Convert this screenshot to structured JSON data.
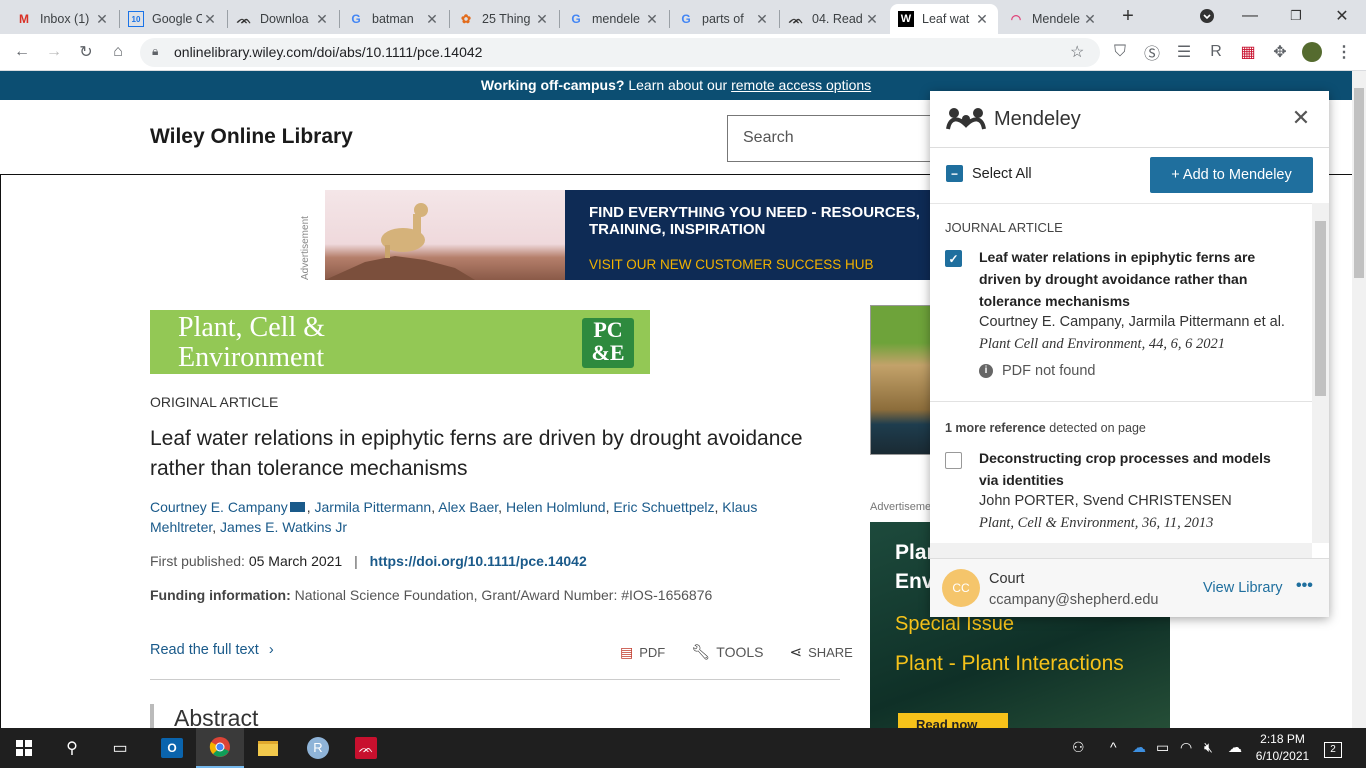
{
  "browser": {
    "tabs": [
      {
        "label": "Inbox (1)",
        "favicon": "gmail-icon",
        "active": false
      },
      {
        "label": "Google C",
        "favicon": "google-calendar-icon",
        "active": false
      },
      {
        "label": "Downloa",
        "favicon": "mendeley-icon",
        "active": false
      },
      {
        "label": "batman",
        "favicon": "google-icon",
        "active": false
      },
      {
        "label": "25 Thing",
        "favicon": "butterfly-icon",
        "active": false
      },
      {
        "label": "mendele",
        "favicon": "google-icon",
        "active": false
      },
      {
        "label": "parts of",
        "favicon": "google-icon",
        "active": false
      },
      {
        "label": "04. Read",
        "favicon": "mendeley-icon",
        "active": false
      },
      {
        "label": "Leaf wat",
        "favicon": "wiley-icon",
        "active": true
      },
      {
        "label": "Mendele",
        "favicon": "rainbow-icon",
        "active": false
      }
    ],
    "url": "onlinelibrary.wiley.com/doi/abs/10.1111/pce.14042"
  },
  "banner": {
    "bold": "Working off-campus?",
    "text": " Learn about our ",
    "link": "remote access options"
  },
  "header": {
    "site_title": "Wiley Online Library",
    "search_placeholder": "Search"
  },
  "ad_top": {
    "label": "Advertisement",
    "headline": "FIND EVERYTHING YOU NEED - RESOURCES, TRAINING, INSPIRATION",
    "link": "VISIT OUR NEW CUSTOMER SUCCESS HUB"
  },
  "journal": {
    "name_line1": "Plant, Cell &",
    "name_line2": "Environment",
    "logo_line1": "PC",
    "logo_line2": "&E"
  },
  "article": {
    "type": "ORIGINAL ARTICLE",
    "title": "Leaf water relations in epiphytic ferns are driven by drought avoidance rather than tolerance mechanisms",
    "authors": [
      "Courtney E. Campany",
      "Jarmila Pittermann",
      "Alex Baer",
      "Helen Holmlund",
      "Eric Schuettpelz",
      "Klaus Mehltreter",
      "James E. Watkins Jr"
    ],
    "first_published_label": "First published:",
    "first_published_date": "05 March 2021",
    "doi": "https://doi.org/10.1111/pce.14042",
    "funding_label": "Funding information:",
    "funding_text": "National Science Foundation, Grant/Award Number: #IOS-1656876",
    "read_full": "Read the full text",
    "tools": {
      "pdf": "PDF",
      "tools": "TOOLS",
      "share": "SHARE"
    },
    "abstract_heading": "Abstract"
  },
  "ad_side": {
    "label": "Advertisement",
    "line1": "Plant,",
    "line2": "Environment",
    "special": "Special Issue",
    "topic": "Plant - Plant Interactions",
    "button": "Read now"
  },
  "mendeley": {
    "title": "Mendeley",
    "select_all": "Select All",
    "add_button": "+ Add to Mendeley",
    "section_label": "JOURNAL ARTICLE",
    "items": [
      {
        "checked": true,
        "title": "Leaf water relations in epiphytic ferns are driven by drought avoidance rather than tolerance mechanisms",
        "authors": "Courtney E. Campany, Jarmila Pittermann et al.",
        "source": "Plant Cell and Environment, 44, 6, 6 2021",
        "pdf_status": "PDF not found"
      },
      {
        "checked": false,
        "title": "Deconstructing crop processes and models via identities",
        "authors": "John PORTER, Svend CHRISTENSEN",
        "source": "Plant, Cell & Environment, 36, 11, 2013"
      }
    ],
    "more_refs_bold": "1 more reference",
    "more_refs_text": " detected on page",
    "user_initials": "CC",
    "user_name": "Court",
    "user_email": "ccampany@shepherd.edu",
    "view_library": "View Library",
    "more_menu": "•••"
  },
  "taskbar": {
    "time": "2:18 PM",
    "date": "6/10/2021",
    "notification_count": "2"
  },
  "colors": {
    "banner": "#0c4e72",
    "mendeley_blue": "#1f6f9e",
    "link_blue": "#1a5a8a",
    "journal_green": "#93c855",
    "ad_navy": "#0e2b55",
    "ad_gold": "#f6c21a"
  }
}
